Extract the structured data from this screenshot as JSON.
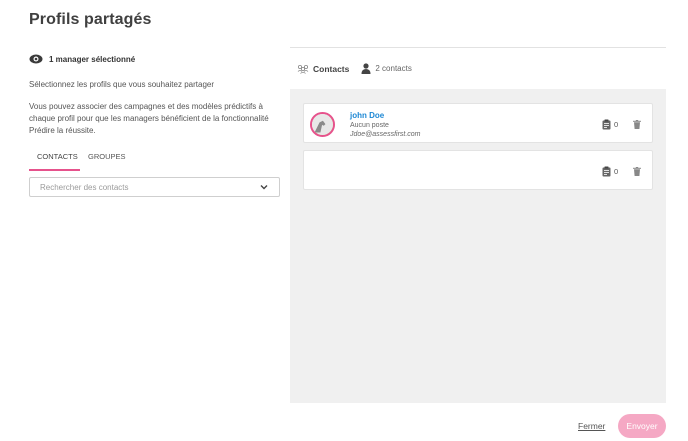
{
  "page": {
    "title": "Profils partagés"
  },
  "left": {
    "manager_selected": "1 manager sélectionné",
    "intro": "Sélectionnez les profils que vous souhaitez partager",
    "description": "Vous pouvez associer des campagnes et des modèles prédictifs à chaque profil pour que les managers bénéficient de la fonctionnalité Prédire la réussite.",
    "tabs": [
      {
        "label": "CONTACTS",
        "active": true
      },
      {
        "label": "GROUPES",
        "active": false
      }
    ],
    "search": {
      "placeholder": "Rechercher des contacts",
      "value": ""
    }
  },
  "right": {
    "header": {
      "title": "Contacts",
      "count": "2 contacts"
    },
    "contacts": [
      {
        "name": "john Doe",
        "job": "Aucun poste",
        "email": "Jdoe@assessfirst.com",
        "campaigns": "0"
      },
      {
        "name": "",
        "job": "",
        "email": "",
        "campaigns": "0"
      }
    ]
  },
  "footer": {
    "close_label": "Fermer",
    "send_label": "Envoyer"
  },
  "colors": {
    "accent": "#e6528c",
    "link": "#1e88d4",
    "send_bg": "#f5a8c4",
    "panel_bg": "#f0f0f0"
  },
  "icons": {
    "manager": "eye-icon",
    "dropdown": "chevron-down-icon",
    "contacts_header": "group-icon",
    "contacts_count": "person-icon",
    "campaign": "clipboard-icon",
    "delete": "trash-icon",
    "avatar": "avatar"
  }
}
